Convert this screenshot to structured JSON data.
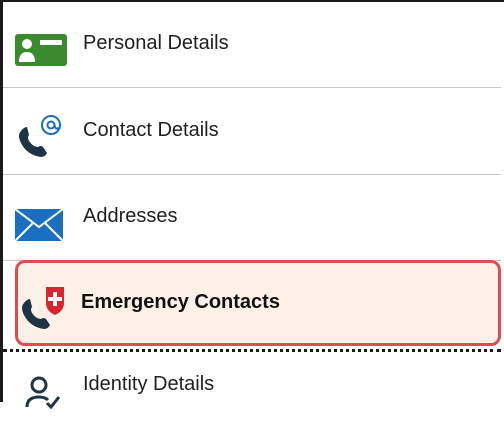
{
  "nav": {
    "items": [
      {
        "label": "Personal Details",
        "icon": "personal-card-icon",
        "selected": false
      },
      {
        "label": "Contact Details",
        "icon": "phone-at-icon",
        "selected": false
      },
      {
        "label": "Addresses",
        "icon": "envelope-icon",
        "selected": false
      },
      {
        "label": "Emergency Contacts",
        "icon": "phone-medical-icon",
        "selected": true
      },
      {
        "label": "Identity Details",
        "icon": "person-check-icon",
        "selected": false
      }
    ]
  },
  "colors": {
    "selected_bg": "#fdf1e7",
    "selected_border": "#e14b52",
    "card_green": "#3a8a2e",
    "phone_dark": "#1e3446",
    "envelope_blue": "#1a6fc0",
    "medical_red": "#d8262e"
  }
}
